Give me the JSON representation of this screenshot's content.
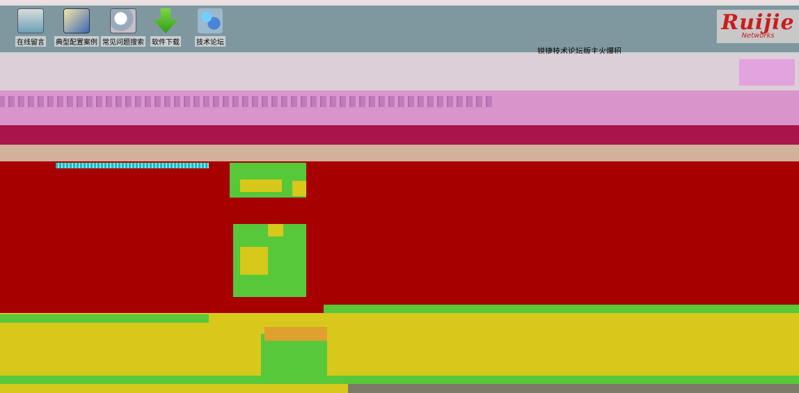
{
  "toolbar": {
    "items": [
      {
        "label": "在线留言",
        "icon": "message-board-icon"
      },
      {
        "label": "典型配置案例",
        "icon": "config-case-icon"
      },
      {
        "label": "常见问题搜索",
        "icon": "faq-search-icon"
      },
      {
        "label": "软件下载",
        "icon": "download-icon"
      },
      {
        "label": "技术论坛",
        "icon": "forum-icon"
      }
    ]
  },
  "brand": {
    "name": "Ruijie",
    "tagline": "Networks",
    "color": "#cc1b1b"
  },
  "marquee": {
    "text": "锐捷技术论坛版主火爆招"
  },
  "colors": {
    "toolbar_bg": "#7f98a0",
    "corrupt_red": "#a70000",
    "corrupt_yellow": "#d8c81c",
    "corrupt_green": "#57c83a",
    "corrupt_pink": "#d894cb"
  }
}
